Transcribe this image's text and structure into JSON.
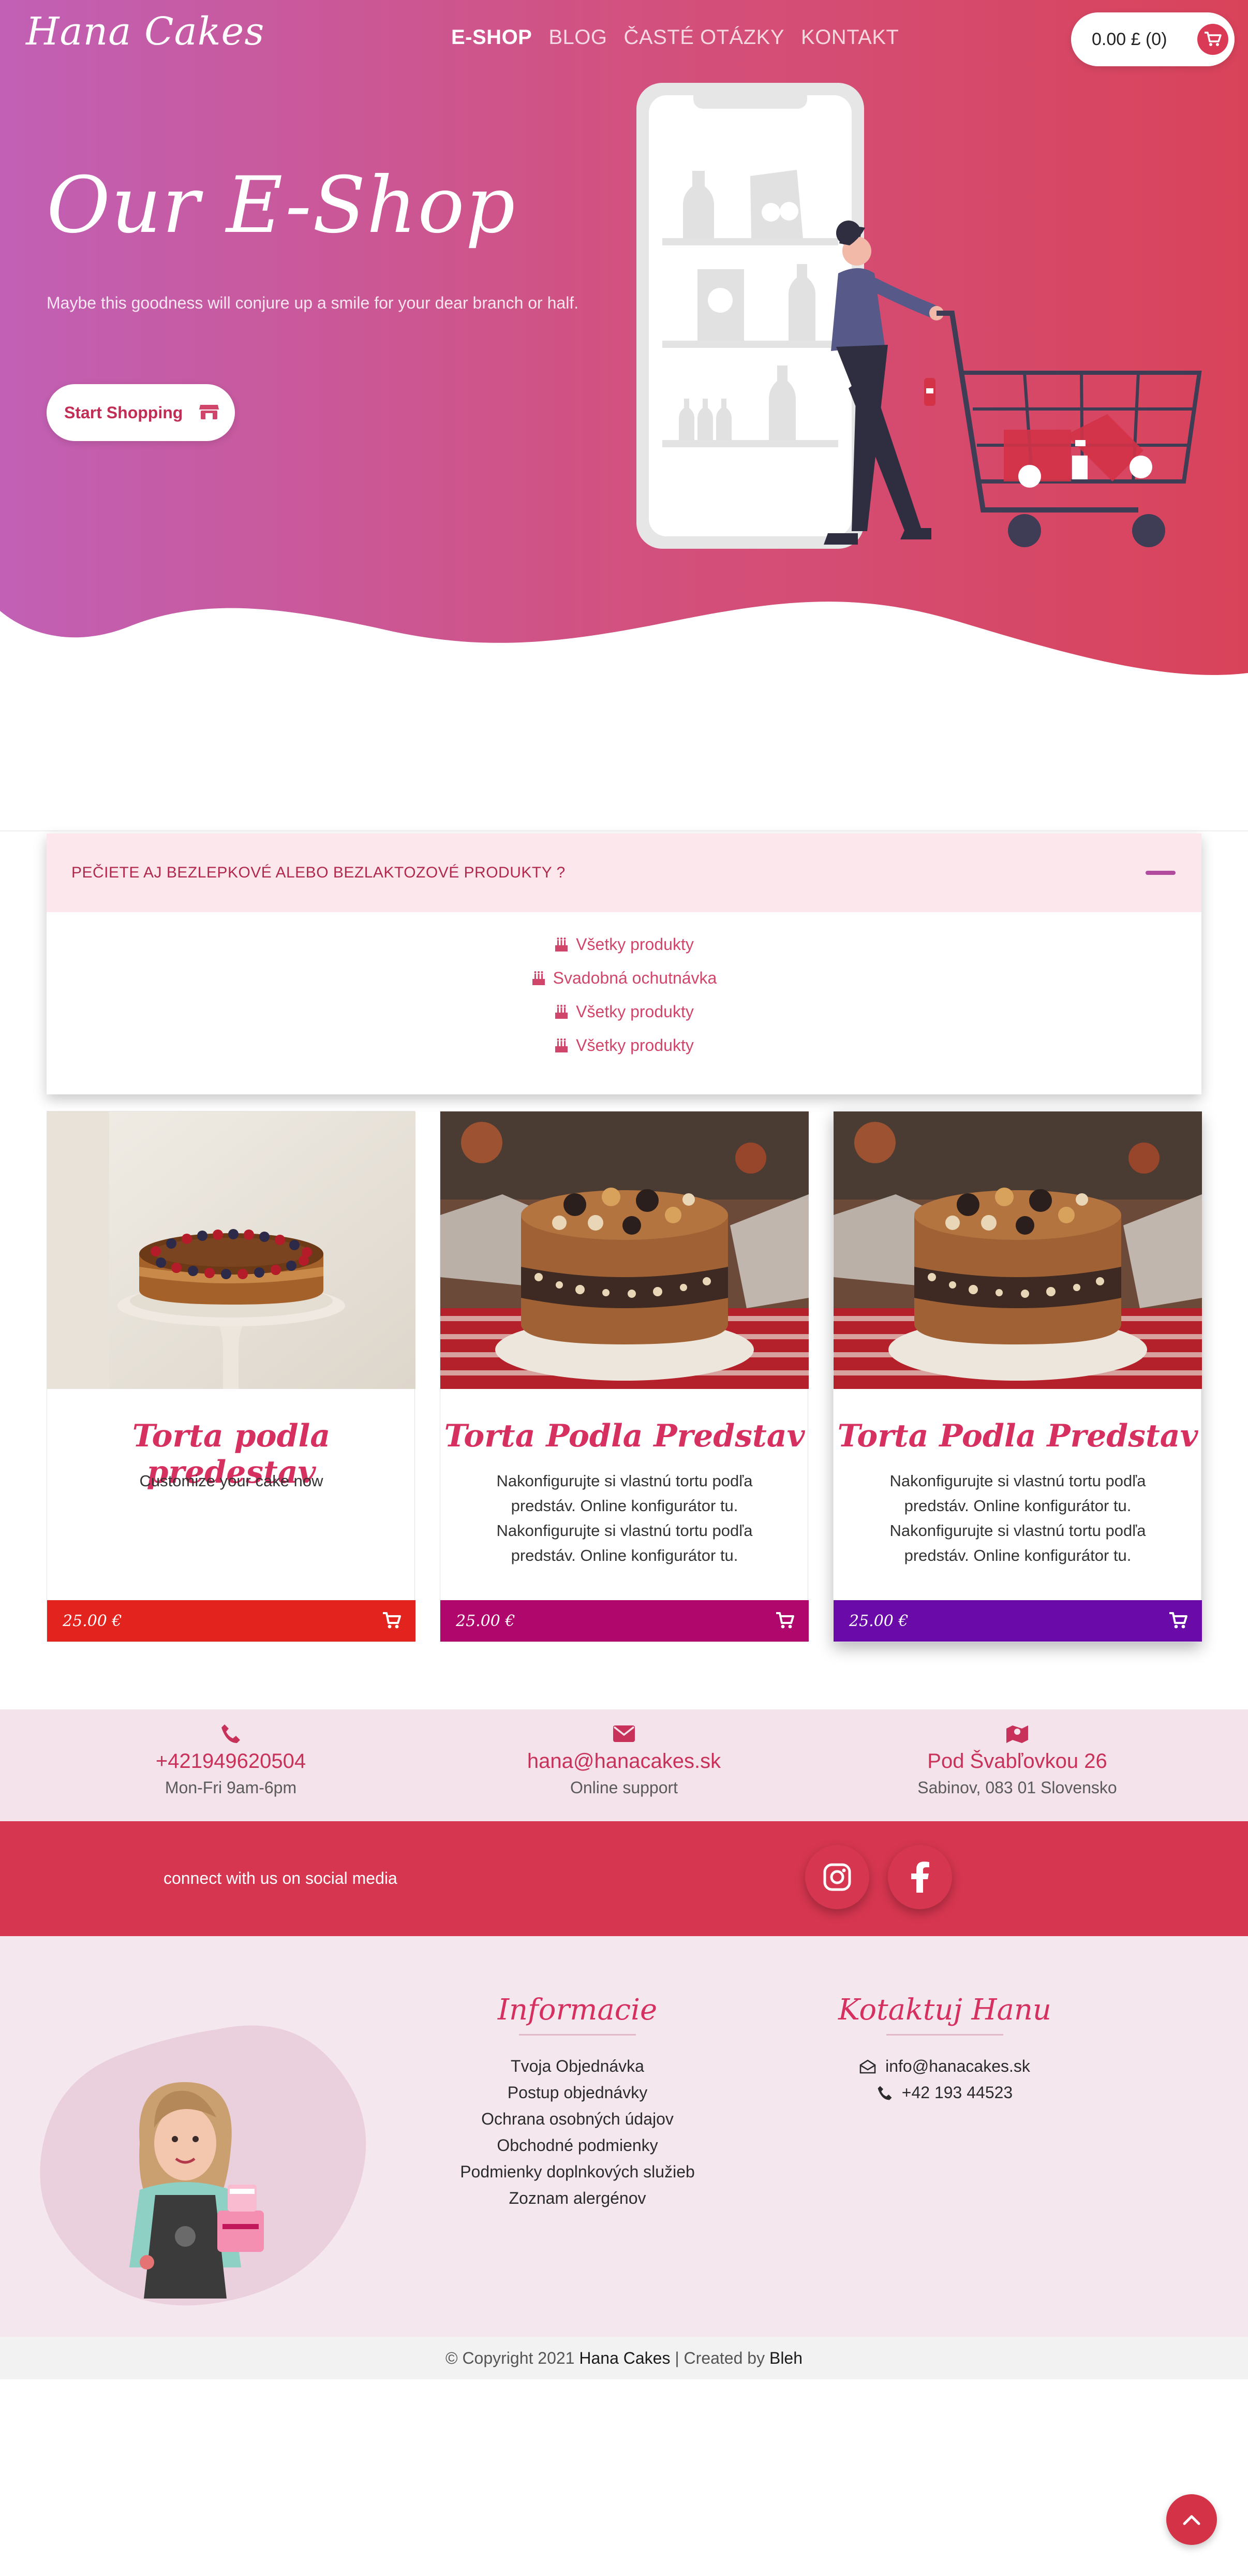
{
  "header": {
    "logo": "Hana Cakes",
    "nav": [
      "E-SHOP",
      "BLOG",
      "ČASTÉ OTÁZKY",
      "KONTAKT"
    ],
    "cart": "0.00 £ (0)"
  },
  "hero": {
    "title": "Our E-Shop",
    "subtitle": "Maybe this goodness will conjure up a smile for your dear branch or half.",
    "button": "Start Shopping"
  },
  "accordion": {
    "question": "PEČIETE AJ BEZLEPKOVÉ ALEBO BEZLAKTOZOVÉ PRODUKTY ?",
    "items": [
      "Všetky produkty",
      "Svadobná ochutnávka",
      "Všetky produkty",
      "Všetky produkty"
    ]
  },
  "products": [
    {
      "title": "Torta podla predestav",
      "desc": "Customize your cake now",
      "price": "25.00 €",
      "color": "#e3241e"
    },
    {
      "title": "Torta Podla Predstav",
      "desc": "Nakonfigurujte si vlastnú tortu podľa predstáv. Online konfigurátor tu. Nakonfigurujte si vlastnú tortu podľa predstáv. Online konfigurátor tu.",
      "price": "25.00 €",
      "color": "#b0076d"
    },
    {
      "title": "Torta Podla Predstav",
      "desc": "Nakonfigurujte si vlastnú tortu podľa predstáv. Online konfigurátor tu. Nakonfigurujte si vlastnú tortu podľa predstáv. Online konfigurátor tu.",
      "price": "25.00 €",
      "color": "#6a0aa8"
    }
  ],
  "contact": {
    "phone": "+421949620504",
    "phone_sub": "Mon-Fri 9am-6pm",
    "email": "hana@hanacakes.sk",
    "email_sub": "Online support",
    "address": "Pod Švabľovkou 26",
    "address_sub": "Sabinov, 083 01 Slovensko"
  },
  "social": {
    "text": "connect with us on social media"
  },
  "footer": {
    "info_title": "Informacie",
    "info_links": [
      "Tvoja Objednávka",
      "Postup objednávky",
      "Ochrana osobných údajov",
      "Obchodné podmienky",
      "Podmienky doplnkových služieb",
      "Zoznam alergénov"
    ],
    "contact_title": "Kotaktuj Hanu",
    "contact_email": "info@hanacakes.sk",
    "contact_phone": "+42 193 44523"
  },
  "copyright": {
    "prefix": "© Copyright 2021",
    "brand": "Hana Cakes",
    "mid": "| Created by",
    "author": "Bleh"
  },
  "colors": {
    "accent": "#d73650",
    "gradient_start": "#c160b5",
    "gradient_end": "#d9435a"
  }
}
